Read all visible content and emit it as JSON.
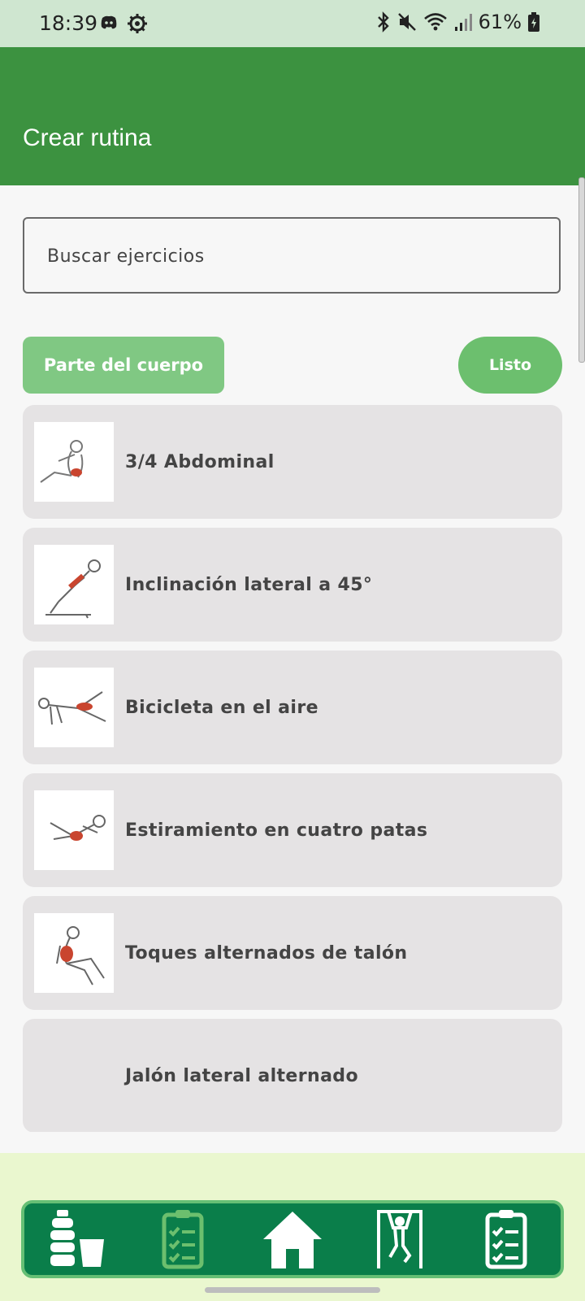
{
  "status_bar": {
    "time": "18:39",
    "battery": "61%"
  },
  "header": {
    "title": "Crear rutina"
  },
  "search": {
    "placeholder": "Buscar ejercicios"
  },
  "filters": {
    "body_part_label": "Parte del cuerpo",
    "done_label": "Listo"
  },
  "exercises": [
    {
      "name": "3/4 Abdominal"
    },
    {
      "name": "Inclinación lateral a 45°"
    },
    {
      "name": "Bicicleta en el aire"
    },
    {
      "name": "Estiramiento en cuatro patas"
    },
    {
      "name": "Toques alternados de talón"
    },
    {
      "name": "Jalón lateral alternado"
    }
  ],
  "bottom_nav": [
    {
      "icon": "water-bottle-icon"
    },
    {
      "icon": "checklist-icon"
    },
    {
      "icon": "home-icon",
      "active": true
    },
    {
      "icon": "pull-up-icon"
    },
    {
      "icon": "clipboard-checklist-icon"
    }
  ],
  "colors": {
    "header": "#3c9240",
    "nav": "#0a7e4a",
    "button": "#80c883",
    "done": "#6cbf6e"
  }
}
